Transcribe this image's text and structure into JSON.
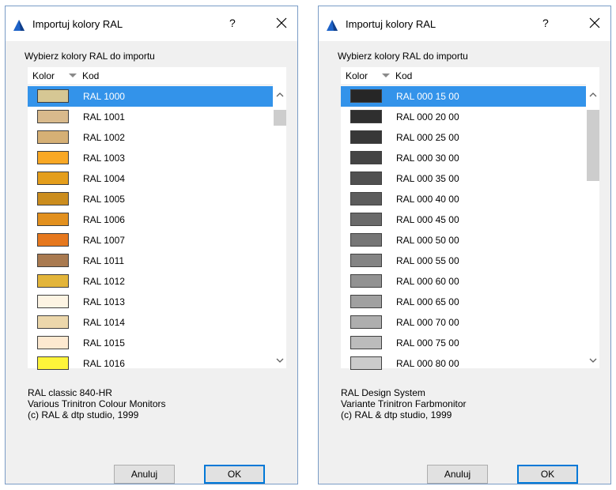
{
  "colors": {
    "selection": "#3393ea",
    "titlebar": "#ffffff",
    "dialog_bg": "#f0f0f0",
    "ok_border": "#0078d7"
  },
  "dialogs": [
    {
      "title": "Importuj kolory RAL",
      "help": "?",
      "prompt": "Wybierz kolory RAL do importu",
      "header": {
        "kolor": "Kolor",
        "kod": "Kod"
      },
      "rows": [
        {
          "code": "RAL 1000",
          "color": "#d6c794",
          "selected": true
        },
        {
          "code": "RAL 1001",
          "color": "#d9ba8c"
        },
        {
          "code": "RAL 1002",
          "color": "#d6b075"
        },
        {
          "code": "RAL 1003",
          "color": "#f9a824"
        },
        {
          "code": "RAL 1004",
          "color": "#e49e1c"
        },
        {
          "code": "RAL 1005",
          "color": "#cb8d1e"
        },
        {
          "code": "RAL 1006",
          "color": "#e2901e"
        },
        {
          "code": "RAL 1007",
          "color": "#e6781e"
        },
        {
          "code": "RAL 1011",
          "color": "#a97a50"
        },
        {
          "code": "RAL 1012",
          "color": "#e3b53a"
        },
        {
          "code": "RAL 1013",
          "color": "#fdf4e3"
        },
        {
          "code": "RAL 1014",
          "color": "#ecd7ab"
        },
        {
          "code": "RAL 1015",
          "color": "#fde9d0"
        },
        {
          "code": "RAL 1016",
          "color": "#fdf43a"
        }
      ],
      "info": [
        "RAL classic 840-HR",
        "Various Trinitron Colour Monitors",
        "(c) RAL & dtp studio, 1999"
      ],
      "cancel_label": "Anuluj",
      "ok_label": "OK"
    },
    {
      "title": "Importuj kolory RAL",
      "help": "?",
      "prompt": "Wybierz kolory RAL do importu",
      "header": {
        "kolor": "Kolor",
        "kod": "Kod"
      },
      "rows": [
        {
          "code": "RAL 000 15 00",
          "color": "#262626",
          "selected": true
        },
        {
          "code": "RAL 000 20 00",
          "color": "#2f2f2f"
        },
        {
          "code": "RAL 000 25 00",
          "color": "#383838"
        },
        {
          "code": "RAL 000 30 00",
          "color": "#444444"
        },
        {
          "code": "RAL 000 35 00",
          "color": "#505050"
        },
        {
          "code": "RAL 000 40 00",
          "color": "#5c5c5c"
        },
        {
          "code": "RAL 000 45 00",
          "color": "#6a6a6a"
        },
        {
          "code": "RAL 000 50 00",
          "color": "#767676"
        },
        {
          "code": "RAL 000 55 00",
          "color": "#848484"
        },
        {
          "code": "RAL 000 60 00",
          "color": "#929292"
        },
        {
          "code": "RAL 000 65 00",
          "color": "#a0a0a0"
        },
        {
          "code": "RAL 000 70 00",
          "color": "#aeaeae"
        },
        {
          "code": "RAL 000 75 00",
          "color": "#bcbcbc"
        },
        {
          "code": "RAL 000 80 00",
          "color": "#cbcbcb"
        }
      ],
      "info": [
        "RAL Design System",
        "Variante Trinitron Farbmonitor",
        "(c) RAL & dtp studio, 1999"
      ],
      "cancel_label": "Anuluj",
      "ok_label": "OK"
    }
  ]
}
